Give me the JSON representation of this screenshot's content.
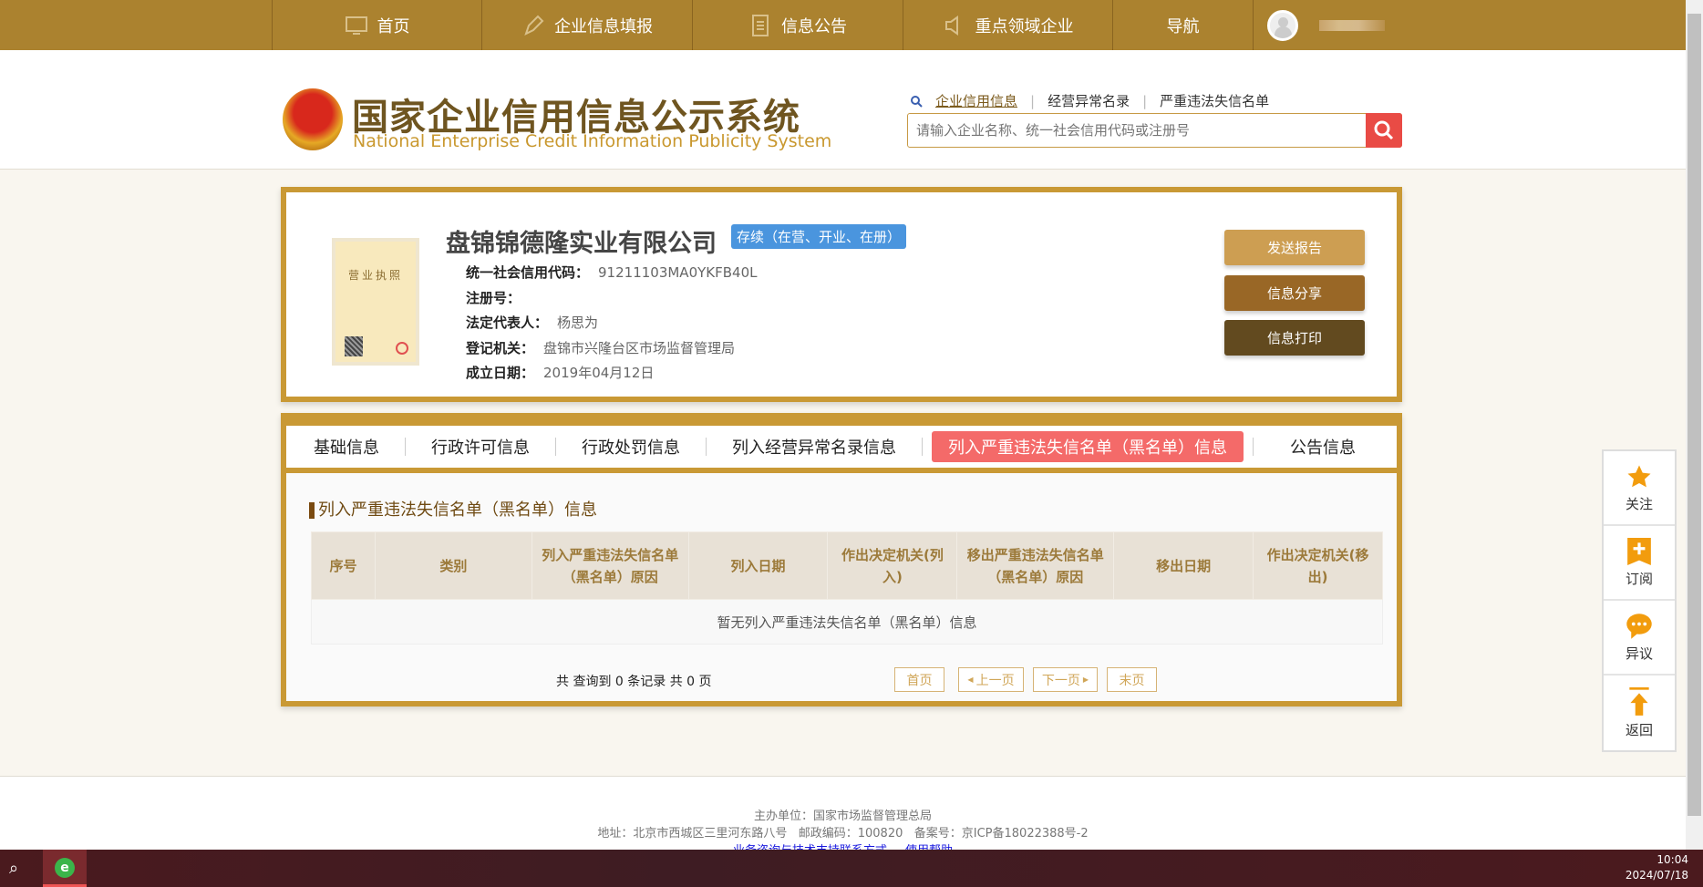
{
  "nav": {
    "items": [
      {
        "label": "首页",
        "icon": "monitor-icon"
      },
      {
        "label": "企业信息填报",
        "icon": "pen-icon"
      },
      {
        "label": "信息公告",
        "icon": "document-icon"
      },
      {
        "label": "重点领域企业",
        "icon": "speaker-icon"
      },
      {
        "label": "导航"
      }
    ]
  },
  "header": {
    "title_cn": "国家企业信用信息公示系统",
    "title_en": "National Enterprise Credit Information Publicity System",
    "search_links": [
      "企业信用信息",
      "经营异常名录",
      "严重违法失信名单"
    ],
    "search_placeholder": "请输入企业名称、统一社会信用代码或注册号"
  },
  "license_image": {
    "title": "营业执照"
  },
  "company": {
    "name": "盘锦锦德隆实业有限公司",
    "status": "存续（在营、开业、在册）",
    "fields": [
      {
        "label": "统一社会信用代码：",
        "value": "91211103MA0YKFB40L"
      },
      {
        "label": "注册号：",
        "value": ""
      },
      {
        "label": "法定代表人：",
        "value": "杨思为"
      },
      {
        "label": "登记机关：",
        "value": "盘锦市兴隆台区市场监督管理局"
      },
      {
        "label": "成立日期：",
        "value": "2019年04月12日"
      }
    ]
  },
  "actions": {
    "send": "发送报告",
    "share": "信息分享",
    "print": "信息打印"
  },
  "action_colors": {
    "send": "#cd9e52",
    "share": "#996726",
    "print": "#624a1f"
  },
  "tabs": [
    "基础信息",
    "行政许可信息",
    "行政处罚信息",
    "列入经营异常名录信息",
    "列入严重违法失信名单（黑名单）信息",
    "公告信息"
  ],
  "active_tab": 4,
  "section": {
    "title": "列入严重违法失信名单（黑名单）信息",
    "columns": [
      "序号",
      "类别",
      "列入严重违法失信名单（黑名单）原因",
      "列入日期",
      "作出决定机关(列入)",
      "移出严重违法失信名单（黑名单）原因",
      "移出日期",
      "作出决定机关(移出)"
    ],
    "empty": "暂无列入严重违法失信名单（黑名单）信息"
  },
  "pagination": {
    "summary": "共 查询到 0 条记录 共 0 页",
    "first": "首页",
    "prev": "上一页",
    "next": "下一页",
    "last": "末页"
  },
  "float_bar": [
    {
      "label": "关注",
      "icon": "star-icon"
    },
    {
      "label": "订阅",
      "icon": "bookmark-plus-icon"
    },
    {
      "label": "异议",
      "icon": "chat-icon"
    },
    {
      "label": "返回",
      "icon": "back-to-top-icon"
    }
  ],
  "footer": {
    "sponsor": "主办单位：国家市场监督管理总局",
    "address": "地址：北京市西城区三里河东路八号   邮政编码：100820   备案号：京ICP备18022388号-2",
    "links": [
      "业务咨询与技术支持联系方式",
      "使用帮助"
    ]
  },
  "taskbar": {
    "time": "10:04",
    "date": "2024/07/18"
  },
  "accent": "#ab822f",
  "border": "#c99935",
  "active_tab_color": "#f46a69"
}
